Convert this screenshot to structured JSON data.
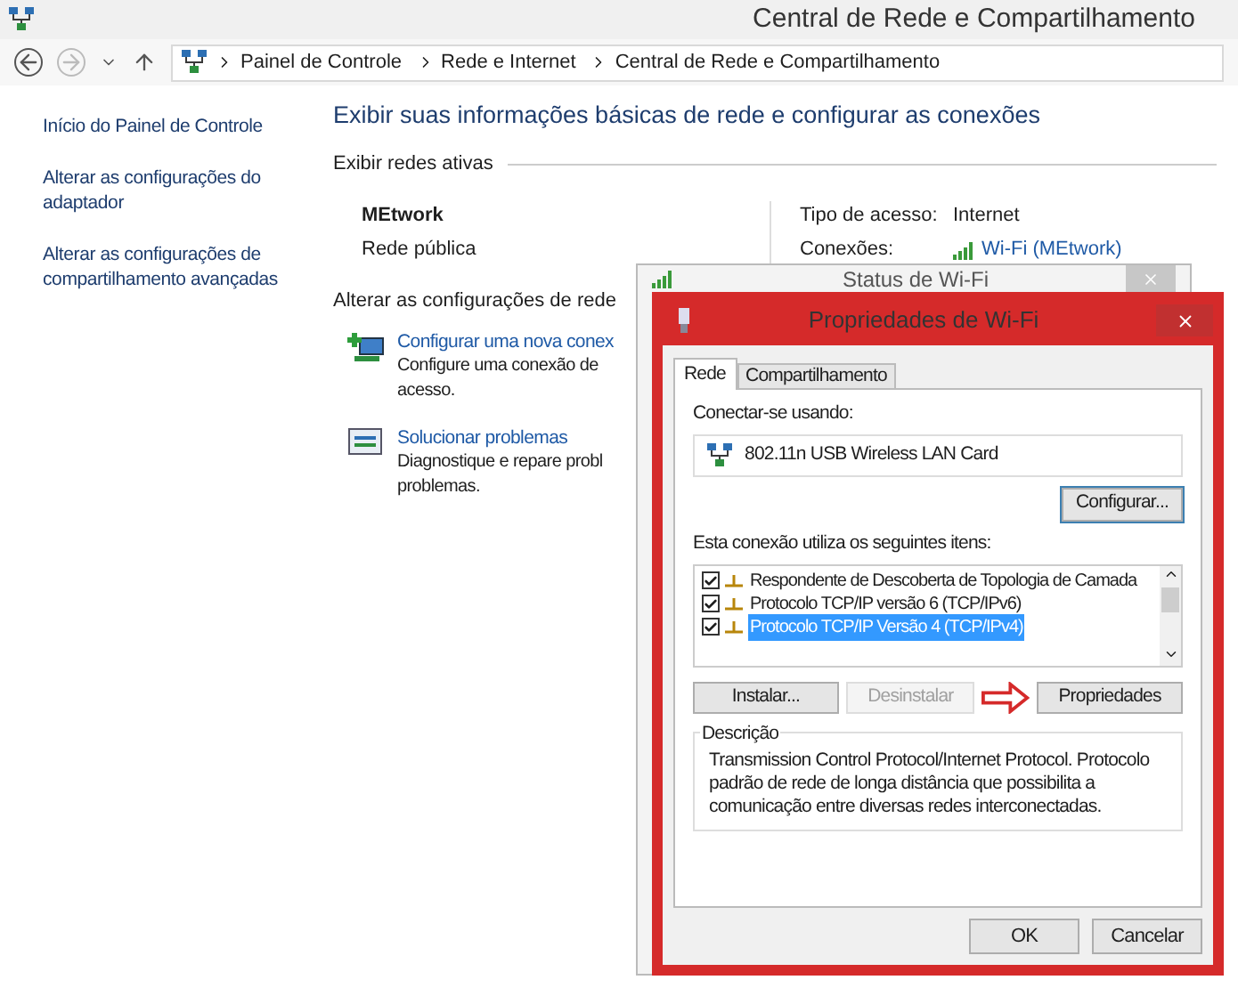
{
  "window": {
    "title": "Central de Rede e Compartilhamento"
  },
  "breadcrumb": [
    "Painel de Controle",
    "Rede e Internet",
    "Central de Rede e Compartilhamento"
  ],
  "sidebar": {
    "links": [
      "Início do Painel de Controle",
      "Alterar as configurações do adaptador",
      "Alterar as configurações de compartilhamento avançadas"
    ]
  },
  "main": {
    "heading": "Exibir suas informações básicas de rede e configurar as conexões",
    "active_networks_label": "Exibir redes ativas",
    "network": {
      "name": "MEtwork",
      "type": "Rede pública"
    },
    "access": [
      {
        "label": "Tipo de acesso:",
        "value": "Internet",
        "kind": "text"
      },
      {
        "label": "Conexões:",
        "value": "Wi-Fi (MEtwork)",
        "kind": "link"
      }
    ],
    "change_label": "Alterar as configurações de rede",
    "tasks": [
      {
        "title": "Configurar uma nova conex",
        "lines": [
          "Configure uma conexão de",
          "acesso."
        ],
        "kind": "new"
      },
      {
        "title": "Solucionar problemas",
        "lines": [
          "Diagnostique e repare probl",
          "problemas."
        ],
        "kind": "fix"
      }
    ]
  },
  "status_window": {
    "title": "Status de Wi-Fi"
  },
  "dialog": {
    "title": "Propriedades de Wi-Fi",
    "tabs": [
      {
        "label": "Rede",
        "selected": true
      },
      {
        "label": "Compartilhamento",
        "selected": false
      }
    ],
    "connect_label": "Conectar-se usando:",
    "adapter": "802.11n USB Wireless LAN Card",
    "configure_button": "Configurar...",
    "items_label": "Esta conexão utiliza os seguintes itens:",
    "items": [
      {
        "label": "Respondente de Descoberta de Topologia de Camada",
        "checked": true,
        "selected": false
      },
      {
        "label": "Protocolo TCP/IP versão 6 (TCP/IPv6)",
        "checked": true,
        "selected": false
      },
      {
        "label": "Protocolo TCP/IP Versão 4 (TCP/IPv4)",
        "checked": true,
        "selected": true
      }
    ],
    "buttons": [
      {
        "label": "Instalar...",
        "disabled": false
      },
      {
        "label": "Desinstalar",
        "disabled": true
      },
      {
        "label": "Propriedades",
        "disabled": false
      }
    ],
    "description": {
      "title": "Descrição",
      "text": "Transmission Control Protocol/Internet Protocol. Protocolo padrão de rede de longa distância que possibilita a comunicação entre diversas redes interconectadas."
    },
    "footer_buttons": [
      "OK",
      "Cancelar"
    ]
  }
}
